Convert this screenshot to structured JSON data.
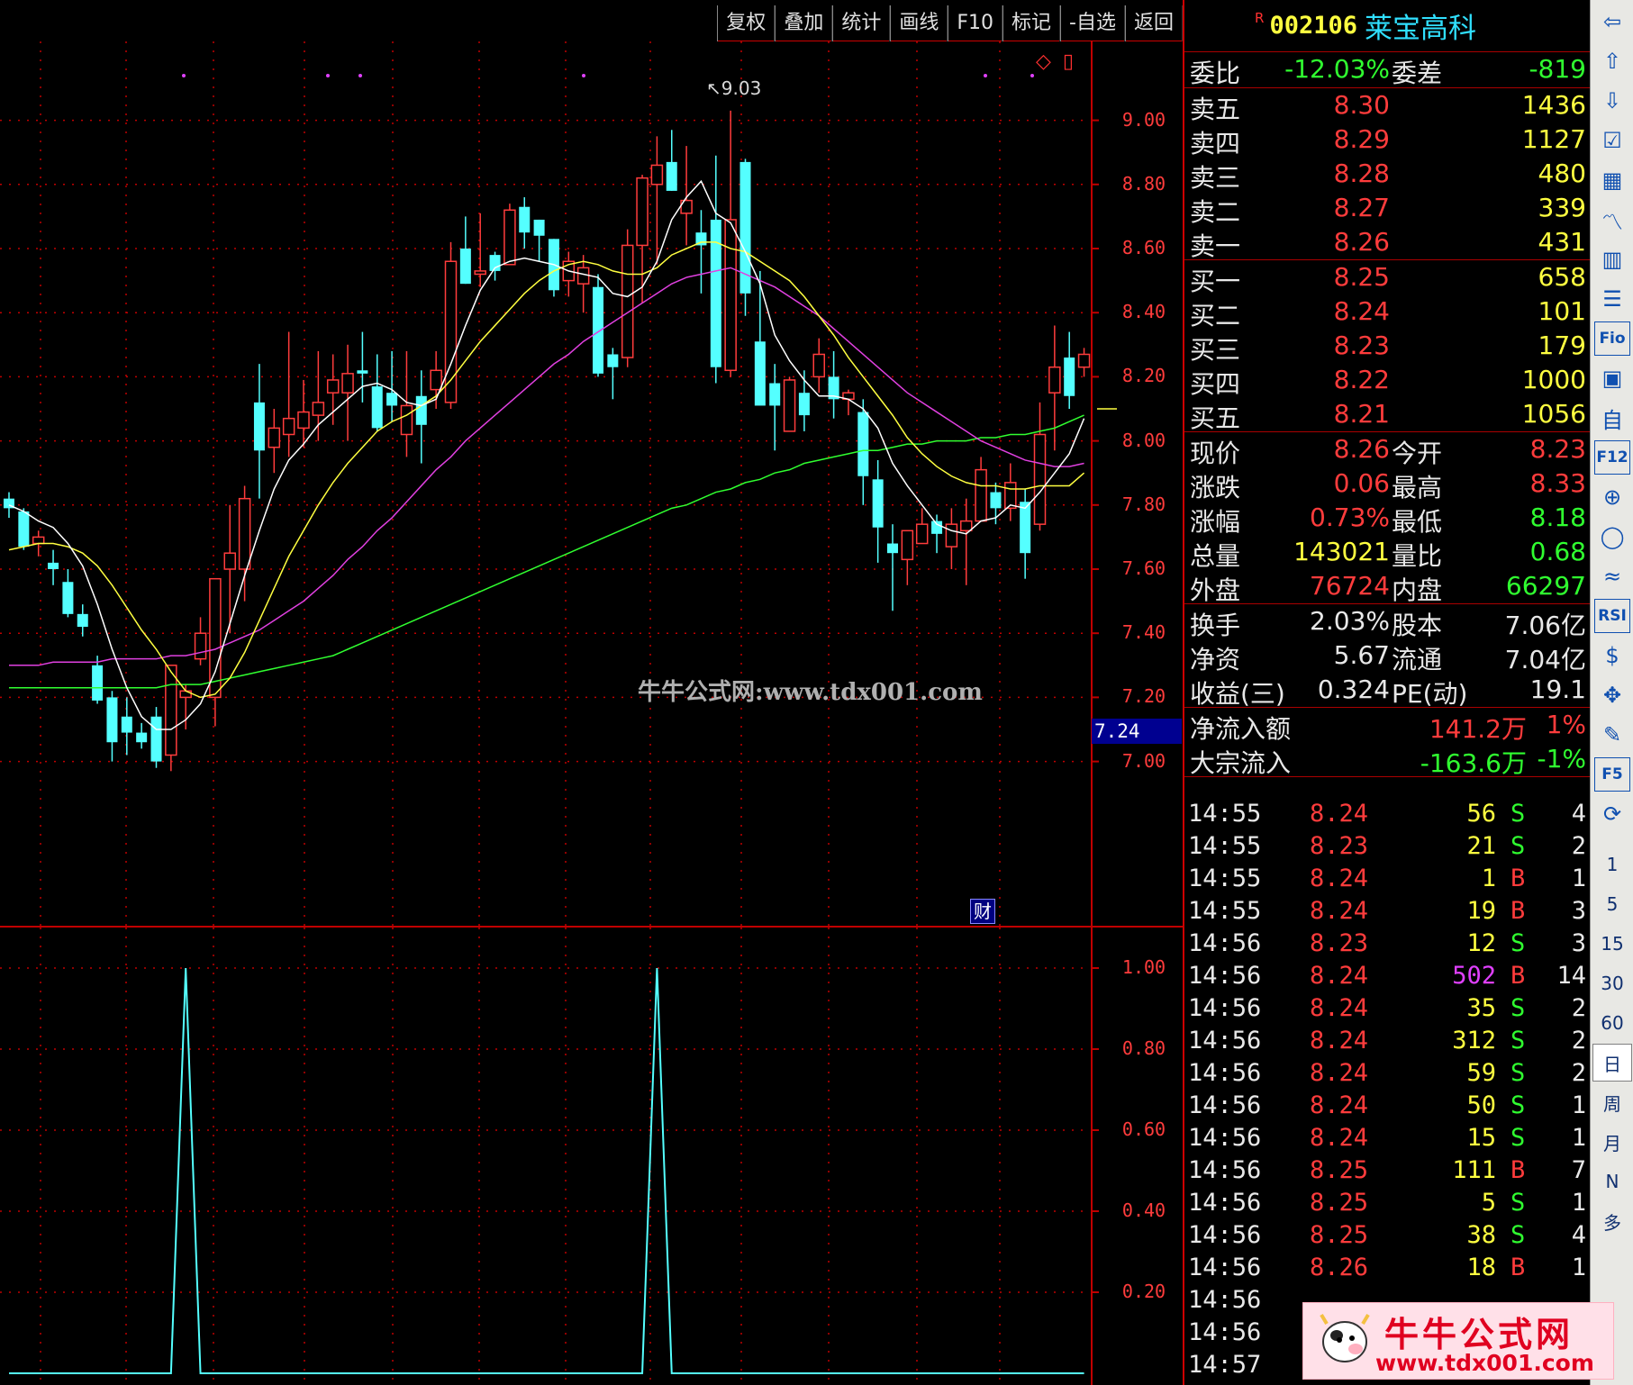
{
  "toolbar": {
    "buttons": [
      "复权",
      "叠加",
      "统计",
      "画线",
      "F10",
      "标记",
      "-自选",
      "返回"
    ]
  },
  "stock": {
    "flag": "R",
    "code": "002106",
    "name": "莱宝高科"
  },
  "price_axis": [
    "9.00",
    "8.80",
    "8.60",
    "8.40",
    "8.20",
    "8.00",
    "7.80",
    "7.60",
    "7.40",
    "7.20",
    "7.00"
  ],
  "indicator_axis": [
    "1.00",
    "0.80",
    "0.60",
    "0.40",
    "0.20"
  ],
  "chart": {
    "max_label": "9.03",
    "current_tag": "7.24",
    "badge": "财",
    "watermark": "牛牛公式网:www.tdx001.com"
  },
  "chart_data": {
    "type": "candlestick",
    "ylim": [
      6.9,
      9.1
    ],
    "candles": [
      [
        7.82,
        7.84,
        7.76,
        7.79
      ],
      [
        7.78,
        7.79,
        7.66,
        7.67
      ],
      [
        7.68,
        7.72,
        7.64,
        7.7
      ],
      [
        7.62,
        7.66,
        7.55,
        7.6
      ],
      [
        7.56,
        7.6,
        7.45,
        7.46
      ],
      [
        7.46,
        7.49,
        7.39,
        7.42
      ],
      [
        7.3,
        7.33,
        7.18,
        7.19
      ],
      [
        7.2,
        7.22,
        7.0,
        7.06
      ],
      [
        7.14,
        7.2,
        7.02,
        7.09
      ],
      [
        7.09,
        7.12,
        7.04,
        7.06
      ],
      [
        7.14,
        7.17,
        6.98,
        7.0
      ],
      [
        7.02,
        7.3,
        6.97,
        7.3
      ],
      [
        7.2,
        7.24,
        7.1,
        7.22
      ],
      [
        7.32,
        7.45,
        7.3,
        7.4
      ],
      [
        7.2,
        7.57,
        7.11,
        7.57
      ],
      [
        7.6,
        7.8,
        7.4,
        7.65
      ],
      [
        7.6,
        7.86,
        7.5,
        7.82
      ],
      [
        8.12,
        8.24,
        7.82,
        7.97
      ],
      [
        7.98,
        8.1,
        7.9,
        8.04
      ],
      [
        8.02,
        8.34,
        7.95,
        8.07
      ],
      [
        8.04,
        8.19,
        7.98,
        8.09
      ],
      [
        8.08,
        8.28,
        8.0,
        8.12
      ],
      [
        8.15,
        8.27,
        8.05,
        8.19
      ],
      [
        8.15,
        8.3,
        8.0,
        8.21
      ],
      [
        8.22,
        8.34,
        8.12,
        8.21
      ],
      [
        8.17,
        8.27,
        8.03,
        8.04
      ],
      [
        8.15,
        8.28,
        8.06,
        8.11
      ],
      [
        8.02,
        8.28,
        7.95,
        8.11
      ],
      [
        8.14,
        8.22,
        7.93,
        8.05
      ],
      [
        8.16,
        8.28,
        8.1,
        8.22
      ],
      [
        8.12,
        8.62,
        8.1,
        8.56
      ],
      [
        8.6,
        8.7,
        8.49,
        8.49
      ],
      [
        8.52,
        8.71,
        8.48,
        8.53
      ],
      [
        8.58,
        8.59,
        8.5,
        8.53
      ],
      [
        8.55,
        8.74,
        8.55,
        8.72
      ],
      [
        8.73,
        8.76,
        8.6,
        8.65
      ],
      [
        8.69,
        8.69,
        8.56,
        8.64
      ],
      [
        8.63,
        8.63,
        8.45,
        8.47
      ],
      [
        8.5,
        8.59,
        8.45,
        8.56
      ],
      [
        8.49,
        8.58,
        8.4,
        8.54
      ],
      [
        8.48,
        8.52,
        8.2,
        8.21
      ],
      [
        8.27,
        8.29,
        8.13,
        8.23
      ],
      [
        8.26,
        8.66,
        8.23,
        8.61
      ],
      [
        8.61,
        8.83,
        8.43,
        8.82
      ],
      [
        8.8,
        8.95,
        8.55,
        8.86
      ],
      [
        8.87,
        8.97,
        8.78,
        8.78
      ],
      [
        8.71,
        8.92,
        8.61,
        8.75
      ],
      [
        8.65,
        8.72,
        8.46,
        8.61
      ],
      [
        8.69,
        8.89,
        8.18,
        8.23
      ],
      [
        8.22,
        9.03,
        8.2,
        8.69
      ],
      [
        8.87,
        8.88,
        8.39,
        8.46
      ],
      [
        8.31,
        8.53,
        8.21,
        8.11
      ],
      [
        8.18,
        8.24,
        7.97,
        8.11
      ],
      [
        8.03,
        8.2,
        8.06,
        8.19
      ],
      [
        8.15,
        8.22,
        8.03,
        8.08
      ],
      [
        8.2,
        8.32,
        8.15,
        8.27
      ],
      [
        8.2,
        8.28,
        8.07,
        8.13
      ],
      [
        8.13,
        8.16,
        8.08,
        8.15
      ],
      [
        8.09,
        8.13,
        7.8,
        7.89
      ],
      [
        7.88,
        7.94,
        7.62,
        7.73
      ],
      [
        7.68,
        7.74,
        7.47,
        7.65
      ],
      [
        7.63,
        7.67,
        7.55,
        7.72
      ],
      [
        7.68,
        7.79,
        7.7,
        7.74
      ],
      [
        7.75,
        7.77,
        7.65,
        7.71
      ],
      [
        7.67,
        7.79,
        7.6,
        7.74
      ],
      [
        7.72,
        7.82,
        7.55,
        7.75
      ],
      [
        7.75,
        7.95,
        7.78,
        7.91
      ],
      [
        7.84,
        7.87,
        7.74,
        7.79
      ],
      [
        7.79,
        7.93,
        7.75,
        7.87
      ],
      [
        7.81,
        7.85,
        7.57,
        7.65
      ],
      [
        7.74,
        8.12,
        7.72,
        8.02
      ],
      [
        8.15,
        8.36,
        7.97,
        8.23
      ],
      [
        8.26,
        8.34,
        8.1,
        8.14
      ],
      [
        8.23,
        8.29,
        8.2,
        8.27
      ]
    ],
    "ma5": [
      7.8,
      7.78,
      7.75,
      7.73,
      7.68,
      7.61,
      7.49,
      7.35,
      7.23,
      7.14,
      7.1,
      7.1,
      7.13,
      7.18,
      7.28,
      7.43,
      7.58,
      7.72,
      7.85,
      7.94,
      7.99,
      8.05,
      8.09,
      8.13,
      8.17,
      8.18,
      8.16,
      8.12,
      8.11,
      8.13,
      8.24,
      8.36,
      8.47,
      8.54,
      8.56,
      8.57,
      8.56,
      8.55,
      8.53,
      8.52,
      8.51,
      8.46,
      8.45,
      8.48,
      8.56,
      8.69,
      8.76,
      8.81,
      8.71,
      8.68,
      8.59,
      8.49,
      8.33,
      8.25,
      8.19,
      8.14,
      8.14,
      8.13,
      8.1,
      8.04,
      7.93,
      7.86,
      7.8,
      7.74,
      7.72,
      7.71,
      7.75,
      7.76,
      7.8,
      7.79,
      7.84,
      7.9,
      7.96,
      8.07
    ],
    "ma10": [
      7.66,
      7.67,
      7.68,
      7.68,
      7.67,
      7.65,
      7.61,
      7.55,
      7.48,
      7.41,
      7.35,
      7.28,
      7.22,
      7.2,
      7.21,
      7.26,
      7.34,
      7.44,
      7.54,
      7.64,
      7.72,
      7.8,
      7.87,
      7.93,
      7.98,
      8.03,
      8.06,
      8.08,
      8.11,
      8.14,
      8.19,
      8.25,
      8.31,
      8.36,
      8.41,
      8.46,
      8.5,
      8.53,
      8.55,
      8.56,
      8.55,
      8.53,
      8.52,
      8.52,
      8.54,
      8.58,
      8.6,
      8.62,
      8.62,
      8.6,
      8.59,
      8.56,
      8.53,
      8.5,
      8.45,
      8.39,
      8.33,
      8.26,
      8.2,
      8.14,
      8.08,
      8.01,
      7.96,
      7.92,
      7.89,
      7.87,
      7.86,
      7.86,
      7.85,
      7.85,
      7.86,
      7.86,
      7.86,
      7.9
    ],
    "ma20": [
      7.3,
      7.3,
      7.3,
      7.31,
      7.31,
      7.31,
      7.31,
      7.32,
      7.32,
      7.32,
      7.32,
      7.33,
      7.33,
      7.34,
      7.35,
      7.37,
      7.39,
      7.41,
      7.44,
      7.47,
      7.5,
      7.54,
      7.58,
      7.63,
      7.67,
      7.72,
      7.76,
      7.81,
      7.86,
      7.91,
      7.95,
      8.0,
      8.04,
      8.08,
      8.12,
      8.16,
      8.2,
      8.24,
      8.27,
      8.31,
      8.34,
      8.37,
      8.4,
      8.43,
      8.46,
      8.49,
      8.51,
      8.52,
      8.53,
      8.54,
      8.52,
      8.5,
      8.48,
      8.45,
      8.42,
      8.39,
      8.35,
      8.31,
      8.27,
      8.23,
      8.19,
      8.15,
      8.12,
      8.09,
      8.06,
      8.03,
      8.0,
      7.98,
      7.96,
      7.94,
      7.93,
      7.92,
      7.92,
      7.93
    ],
    "ma60": [
      7.23,
      7.23,
      7.23,
      7.23,
      7.23,
      7.23,
      7.23,
      7.23,
      7.23,
      7.23,
      7.23,
      7.24,
      7.24,
      7.24,
      7.25,
      7.26,
      7.27,
      7.28,
      7.29,
      7.3,
      7.31,
      7.32,
      7.33,
      7.35,
      7.37,
      7.39,
      7.41,
      7.43,
      7.45,
      7.47,
      7.49,
      7.51,
      7.53,
      7.55,
      7.57,
      7.59,
      7.61,
      7.63,
      7.65,
      7.67,
      7.69,
      7.71,
      7.73,
      7.75,
      7.77,
      7.79,
      7.8,
      7.82,
      7.84,
      7.85,
      7.87,
      7.88,
      7.9,
      7.91,
      7.93,
      7.94,
      7.95,
      7.96,
      7.97,
      7.97,
      7.98,
      7.99,
      7.99,
      8.0,
      8.0,
      8.0,
      8.01,
      8.01,
      8.02,
      8.02,
      8.03,
      8.04,
      8.06,
      8.08
    ],
    "indicator": {
      "ylim": [
        0,
        1
      ],
      "values": [
        0,
        0,
        0,
        0,
        0,
        0,
        0,
        0,
        0,
        0,
        0,
        0,
        1,
        0,
        0,
        0,
        0,
        0,
        0,
        0,
        0,
        0,
        0,
        0,
        0,
        0,
        0,
        0,
        0,
        0,
        0,
        0,
        0,
        0,
        0,
        0,
        0,
        0,
        0,
        0,
        0,
        0,
        0,
        0,
        1,
        0,
        0,
        0,
        0,
        0,
        0,
        0,
        0,
        0,
        0,
        0,
        0,
        0,
        0,
        0,
        0,
        0,
        0,
        0,
        0,
        0,
        0,
        0,
        0,
        0,
        0,
        0,
        0,
        0
      ]
    }
  },
  "quote": {
    "wei_bi": {
      "label": "委比",
      "value": "-12.03%",
      "label2": "委差",
      "value2": "-819"
    },
    "sell": [
      {
        "label": "卖五",
        "price": "8.30",
        "vol": "1436"
      },
      {
        "label": "卖四",
        "price": "8.29",
        "vol": "1127"
      },
      {
        "label": "卖三",
        "price": "8.28",
        "vol": "480"
      },
      {
        "label": "卖二",
        "price": "8.27",
        "vol": "339"
      },
      {
        "label": "卖一",
        "price": "8.26",
        "vol": "431"
      }
    ],
    "buy": [
      {
        "label": "买一",
        "price": "8.25",
        "vol": "658"
      },
      {
        "label": "买二",
        "price": "8.24",
        "vol": "101"
      },
      {
        "label": "买三",
        "price": "8.23",
        "vol": "179"
      },
      {
        "label": "买四",
        "price": "8.22",
        "vol": "1000"
      },
      {
        "label": "买五",
        "price": "8.21",
        "vol": "1056"
      }
    ],
    "stats": [
      {
        "l1": "现价",
        "v1": "8.26",
        "c1": "red",
        "l2": "今开",
        "v2": "8.23",
        "c2": "red"
      },
      {
        "l1": "涨跌",
        "v1": "0.06",
        "c1": "red",
        "l2": "最高",
        "v2": "8.33",
        "c2": "red"
      },
      {
        "l1": "涨幅",
        "v1": "0.73%",
        "c1": "red",
        "l2": "最低",
        "v2": "8.18",
        "c2": "grn"
      },
      {
        "l1": "总量",
        "v1": "143021",
        "c1": "yel",
        "l2": "量比",
        "v2": "0.68",
        "c2": "grn"
      },
      {
        "l1": "外盘",
        "v1": "76724",
        "c1": "red",
        "l2": "内盘",
        "v2": "66297",
        "c2": "grn"
      }
    ],
    "fundamentals": [
      {
        "l1": "换手",
        "v1": "2.03%",
        "l2": "股本",
        "v2": "7.06亿"
      },
      {
        "l1": "净资",
        "v1": "5.67",
        "l2": "流通",
        "v2": "7.04亿"
      },
      {
        "l1": "收益(三)",
        "v1": "0.324",
        "l2": "PE(动)",
        "v2": "19.1"
      }
    ],
    "flow": [
      {
        "label": "净流入额",
        "value": "141.2万",
        "pct": "1%",
        "color": "red"
      },
      {
        "label": "大宗流入",
        "value": "-163.6万",
        "pct": "-1%",
        "color": "grn"
      }
    ]
  },
  "ticks": [
    {
      "t": "14:55",
      "p": "8.24",
      "v": "56",
      "bs": "S",
      "n": "4"
    },
    {
      "t": "14:55",
      "p": "8.23",
      "v": "21",
      "bs": "S",
      "n": "2"
    },
    {
      "t": "14:55",
      "p": "8.24",
      "v": "1",
      "bs": "B",
      "n": "1"
    },
    {
      "t": "14:55",
      "p": "8.24",
      "v": "19",
      "bs": "B",
      "n": "3"
    },
    {
      "t": "14:56",
      "p": "8.23",
      "v": "12",
      "bs": "S",
      "n": "3"
    },
    {
      "t": "14:56",
      "p": "8.24",
      "v": "502",
      "bs": "B",
      "n": "14"
    },
    {
      "t": "14:56",
      "p": "8.24",
      "v": "35",
      "bs": "S",
      "n": "2"
    },
    {
      "t": "14:56",
      "p": "8.24",
      "v": "312",
      "bs": "S",
      "n": "2"
    },
    {
      "t": "14:56",
      "p": "8.24",
      "v": "59",
      "bs": "S",
      "n": "2"
    },
    {
      "t": "14:56",
      "p": "8.24",
      "v": "50",
      "bs": "S",
      "n": "1"
    },
    {
      "t": "14:56",
      "p": "8.24",
      "v": "15",
      "bs": "S",
      "n": "1"
    },
    {
      "t": "14:56",
      "p": "8.25",
      "v": "111",
      "bs": "B",
      "n": "7"
    },
    {
      "t": "14:56",
      "p": "8.25",
      "v": "5",
      "bs": "S",
      "n": "1"
    },
    {
      "t": "14:56",
      "p": "8.25",
      "v": "38",
      "bs": "S",
      "n": "4"
    },
    {
      "t": "14:56",
      "p": "8.26",
      "v": "18",
      "bs": "B",
      "n": "1"
    },
    {
      "t": "14:56",
      "p": "",
      "v": "",
      "bs": "",
      "n": ""
    },
    {
      "t": "14:56",
      "p": "",
      "v": "",
      "bs": "",
      "n": ""
    },
    {
      "t": "14:57",
      "p": "",
      "v": "",
      "bs": "",
      "n": ""
    }
  ],
  "sidebar": {
    "icons": [
      "arrow-left-icon",
      "arrow-up-icon",
      "arrow-down-icon",
      "checklist-icon",
      "grid-icon",
      "line-chart-icon",
      "candle-icon",
      "list-icon",
      "f10-icon",
      "block-icon",
      "self-icon",
      "f12-icon",
      "zoom-icon",
      "circle-icon",
      "wave-icon",
      "rsi-icon",
      "dollar-icon",
      "move-icon",
      "pencil-icon",
      "f5-icon",
      "refresh-icon"
    ],
    "icon_text": {
      "rsi": "RSI",
      "fio": "Fio",
      "f12": "F12",
      "f5": "F5"
    },
    "periods": [
      "1",
      "5",
      "15",
      "30",
      "60",
      "日",
      "周",
      "月",
      "N",
      "多"
    ],
    "active_period": "日"
  },
  "promo": {
    "title": "牛牛公式网",
    "url": "www.tdx001.com"
  },
  "colors": {
    "up": "#ff3c3c",
    "down": "#54ffff",
    "ma5": "#ffffff",
    "ma10": "#ffff40",
    "ma20": "#e040e0",
    "ma60": "#30ff30",
    "grid": "#c00000",
    "indicator": "#54ffff"
  }
}
